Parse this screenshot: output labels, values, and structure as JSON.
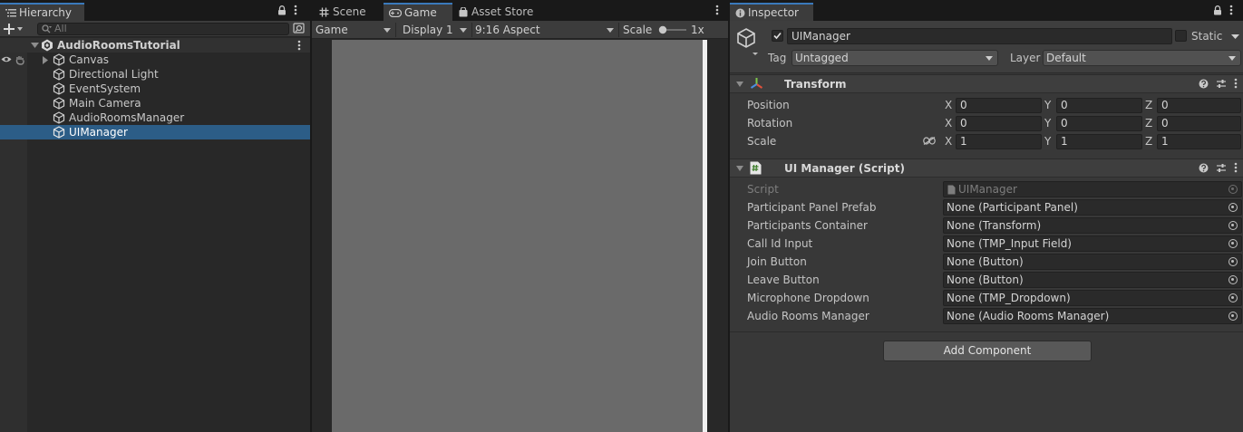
{
  "hierarchy": {
    "tab_label": "Hierarchy",
    "search_placeholder": "All",
    "root": "AudioRoomsTutorial",
    "items": [
      {
        "label": "Canvas",
        "expandable": true
      },
      {
        "label": "Directional Light",
        "expandable": false
      },
      {
        "label": "EventSystem",
        "expandable": false
      },
      {
        "label": "Main Camera",
        "expandable": false
      },
      {
        "label": "AudioRoomsManager",
        "expandable": false
      },
      {
        "label": "UIManager",
        "expandable": false,
        "selected": true
      }
    ]
  },
  "game": {
    "tabs": [
      {
        "label": "Scene",
        "icon": "hash-icon"
      },
      {
        "label": "Game",
        "icon": "gamepad-icon",
        "active": true
      },
      {
        "label": "Asset Store",
        "icon": "bag-icon"
      }
    ],
    "toolbar": {
      "mode": "Game",
      "display": "Display 1",
      "aspect": "9:16 Aspect",
      "scale_label": "Scale",
      "scale_value": "1x"
    }
  },
  "inspector": {
    "tab_label": "Inspector",
    "object_name": "UIManager",
    "static_label": "Static",
    "tag_label": "Tag",
    "tag_value": "Untagged",
    "layer_label": "Layer",
    "layer_value": "Default",
    "transform": {
      "title": "Transform",
      "rows": [
        {
          "label": "Position",
          "x": "0",
          "y": "0",
          "z": "0"
        },
        {
          "label": "Rotation",
          "x": "0",
          "y": "0",
          "z": "0"
        },
        {
          "label": "Scale",
          "x": "1",
          "y": "1",
          "z": "1"
        }
      ]
    },
    "script": {
      "title": "UI Manager (Script)",
      "script_label": "Script",
      "script_value": "UIManager",
      "fields": [
        {
          "label": "Participant Panel Prefab",
          "value": "None (Participant Panel)"
        },
        {
          "label": "Participants Container",
          "value": "None (Transform)"
        },
        {
          "label": "Call Id Input",
          "value": "None (TMP_Input Field)"
        },
        {
          "label": "Join Button",
          "value": "None (Button)"
        },
        {
          "label": "Leave Button",
          "value": "None (Button)"
        },
        {
          "label": "Microphone Dropdown",
          "value": "None (TMP_Dropdown)"
        },
        {
          "label": "Audio Rooms Manager",
          "value": "None (Audio Rooms Manager)"
        }
      ]
    },
    "add_component": "Add Component"
  },
  "colors": {
    "selection": "#2c5d87",
    "tab_accent": "#3a79bb",
    "panel_bg": "#383838",
    "viewport": "#6a6a6a"
  }
}
